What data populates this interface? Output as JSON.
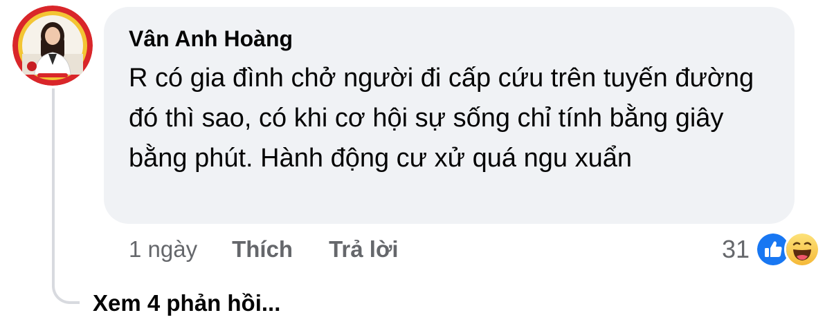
{
  "comment": {
    "author": "Vân Anh Hoàng",
    "text": "R có gia đình chở người đi cấp cứu trên tuyến đường đó thì sao, có khi cơ hội sự sống chỉ tính bằng giây bằng phút. Hành động cư xử quá ngu xuẩn",
    "timestamp": "1 ngày",
    "like_label": "Thích",
    "reply_label": "Trả lời",
    "reaction_count": "31",
    "reactions": [
      "like-icon",
      "haha-icon"
    ]
  },
  "replies": {
    "view_label": "Xem 4 phản hồi..."
  },
  "colors": {
    "bubble_bg": "#f0f2f5",
    "secondary_text": "#65676b",
    "like_blue": "#1877f2",
    "haha_yellow": "#f7c843",
    "thread_line": "#d8dadf"
  }
}
